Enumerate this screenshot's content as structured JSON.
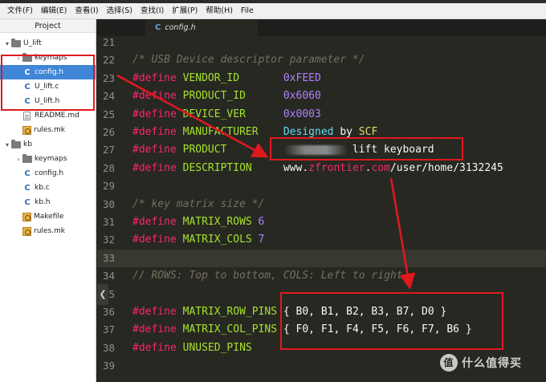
{
  "menubar": {
    "items": [
      "文件(F)",
      "编辑(E)",
      "查看(I)",
      "选择(S)",
      "查找(I)",
      "扩展(P)",
      "帮助(H)",
      "File"
    ]
  },
  "sidebar": {
    "title": "Project",
    "tree": [
      {
        "label": "U_lift",
        "type": "folder",
        "expanded": true,
        "depth": 0
      },
      {
        "label": "keymaps",
        "type": "folder",
        "expanded": false,
        "depth": 1
      },
      {
        "label": "config.h",
        "type": "c",
        "depth": 1,
        "selected": true
      },
      {
        "label": "U_lift.c",
        "type": "c",
        "depth": 1
      },
      {
        "label": "U_lift.h",
        "type": "c",
        "depth": 1
      },
      {
        "label": "README.md",
        "type": "file",
        "depth": 1
      },
      {
        "label": "rules.mk",
        "type": "mk",
        "depth": 1
      },
      {
        "label": "kb",
        "type": "folder",
        "expanded": true,
        "depth": 0
      },
      {
        "label": "keymaps",
        "type": "folder",
        "expanded": false,
        "depth": 1
      },
      {
        "label": "config.h",
        "type": "c",
        "depth": 1
      },
      {
        "label": "kb.c",
        "type": "c",
        "depth": 1
      },
      {
        "label": "kb.h",
        "type": "c",
        "depth": 1
      },
      {
        "label": "Makefile",
        "type": "mk",
        "depth": 1
      },
      {
        "label": "rules.mk",
        "type": "mk",
        "depth": 1
      }
    ]
  },
  "tab": {
    "label": "config.h",
    "icon_glyph": "C"
  },
  "editor": {
    "current_line": 33,
    "lines": [
      {
        "n": "21",
        "parts": []
      },
      {
        "n": "22",
        "parts": [
          {
            "c": "cmt",
            "t": "/* USB Device descriptor parameter */"
          }
        ]
      },
      {
        "n": "23",
        "parts": [
          {
            "c": "kw",
            "t": "#define "
          },
          {
            "c": "id",
            "t": "VENDOR_ID       "
          },
          {
            "c": "num",
            "t": "0xFEED"
          }
        ]
      },
      {
        "n": "24",
        "parts": [
          {
            "c": "kw",
            "t": "#define "
          },
          {
            "c": "id",
            "t": "PRODUCT_ID      "
          },
          {
            "c": "num",
            "t": "0x6060"
          }
        ]
      },
      {
        "n": "25",
        "parts": [
          {
            "c": "kw",
            "t": "#define "
          },
          {
            "c": "id",
            "t": "DEVICE_VER      "
          },
          {
            "c": "num",
            "t": "0x0003"
          }
        ]
      },
      {
        "n": "26",
        "parts": [
          {
            "c": "kw",
            "t": "#define "
          },
          {
            "c": "id",
            "t": "MANUFACTURER    "
          },
          {
            "c": "cyan",
            "t": "Designed "
          },
          {
            "c": "txt",
            "t": "by "
          },
          {
            "c": "str",
            "t": "SCF"
          }
        ]
      },
      {
        "n": "27",
        "parts": [
          {
            "c": "kw",
            "t": "#define "
          },
          {
            "c": "id",
            "t": "PRODUCT         "
          },
          {
            "c": "blur",
            "t": ""
          },
          {
            "c": "txt",
            "t": "lift keyboard"
          }
        ]
      },
      {
        "n": "28",
        "parts": [
          {
            "c": "kw",
            "t": "#define "
          },
          {
            "c": "id",
            "t": "DESCRIPTION     "
          },
          {
            "c": "txt",
            "t": "www."
          },
          {
            "c": "kw",
            "t": "zfrontier"
          },
          {
            "c": "txt",
            "t": "."
          },
          {
            "c": "kw",
            "t": "com"
          },
          {
            "c": "txt",
            "t": "/user/home/3132245"
          }
        ]
      },
      {
        "n": "29",
        "parts": []
      },
      {
        "n": "30",
        "parts": [
          {
            "c": "cmt",
            "t": "/* key matrix size */"
          }
        ]
      },
      {
        "n": "31",
        "parts": [
          {
            "c": "kw",
            "t": "#define "
          },
          {
            "c": "id",
            "t": "MATRIX_ROWS "
          },
          {
            "c": "num",
            "t": "6"
          }
        ]
      },
      {
        "n": "32",
        "parts": [
          {
            "c": "kw",
            "t": "#define "
          },
          {
            "c": "id",
            "t": "MATRIX_COLS "
          },
          {
            "c": "num",
            "t": "7"
          }
        ]
      },
      {
        "n": "33",
        "parts": []
      },
      {
        "n": "34",
        "parts": [
          {
            "c": "cmt",
            "t": "// ROWS: Top to bottom, COLS: Left to right"
          }
        ]
      },
      {
        "n": "35",
        "parts": []
      },
      {
        "n": "36",
        "parts": [
          {
            "c": "kw",
            "t": "#define "
          },
          {
            "c": "id",
            "t": "MATRIX_ROW_PINS "
          },
          {
            "c": "txt",
            "t": "{ B0, B1, B2, B3, B7, D0 }"
          }
        ]
      },
      {
        "n": "37",
        "parts": [
          {
            "c": "kw",
            "t": "#define "
          },
          {
            "c": "id",
            "t": "MATRIX_COL_PINS "
          },
          {
            "c": "txt",
            "t": "{ F0, F1, F4, F5, F6, F7, B6 }"
          }
        ]
      },
      {
        "n": "38",
        "parts": [
          {
            "c": "kw",
            "t": "#define "
          },
          {
            "c": "id",
            "t": "UNUSED_PINS"
          }
        ]
      },
      {
        "n": "39",
        "parts": []
      }
    ]
  },
  "collapse_glyph": "❮",
  "watermark": {
    "badge": "值",
    "text": "什么值得买"
  },
  "colors": {
    "annotation_red": "#e0191f",
    "selection_blue": "#3f86d6",
    "editor_bg": "#272822"
  }
}
